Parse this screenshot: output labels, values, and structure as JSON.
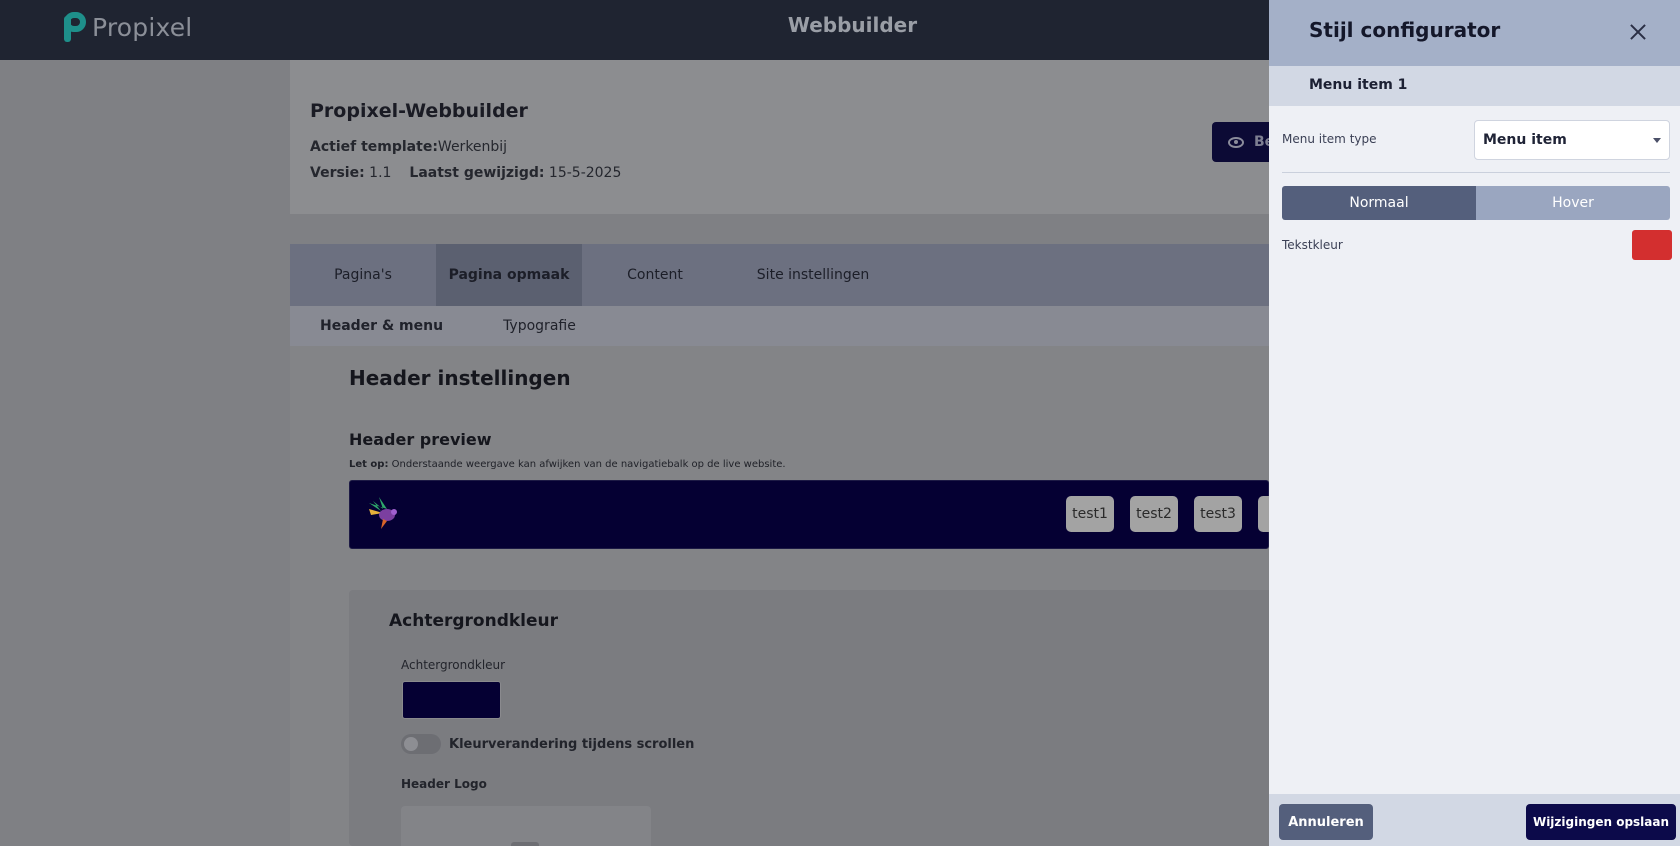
{
  "topbar": {
    "brand": "Propixel",
    "title": "Webbuilder"
  },
  "project": {
    "title": "Propixel-Webbuilder",
    "template_label": "Actief template:",
    "template_value": "Werkenbij",
    "version_label": "Versie:",
    "version_value": "1.1",
    "modified_label": "Laatst gewijzigd:",
    "modified_value": "15-5-2025",
    "preview_button": "Be"
  },
  "tabs": [
    "Pagina's",
    "Pagina opmaak",
    "Content",
    "Site instellingen"
  ],
  "active_tab": "Pagina opmaak",
  "subtabs": [
    "Header & menu",
    "Typografie"
  ],
  "active_subtab": "Header & menu",
  "header_settings": {
    "title": "Header instellingen",
    "preview_title": "Header preview",
    "note_label": "Let op:",
    "note_text": "Onderstaande weergave kan afwijken van de navigatiebalk op de live website.",
    "preview_bg": "#050033",
    "menu_items": [
      "test1",
      "test2",
      "test3"
    ]
  },
  "background": {
    "title": "Achtergrondkleur",
    "label": "Achtergrondkleur",
    "color": "#050033",
    "toggle_label": "Kleurverandering tijdens scrollen",
    "toggle_on": false,
    "logo_label": "Header Logo"
  },
  "panel": {
    "title": "Stijl configurator",
    "subtitle": "Menu item 1",
    "type_label": "Menu item type",
    "type_value": "Menu item",
    "states": [
      "Normaal",
      "Hover"
    ],
    "active_state": "Normaal",
    "text_color_label": "Tekstkleur",
    "text_color": "#d32f2f",
    "cancel": "Annuleren",
    "save": "Wijzigingen opslaan"
  },
  "colors": {
    "topbar": "#1f2431",
    "accent": "#0c0a4a",
    "panel_header": "#a4b0c8"
  }
}
